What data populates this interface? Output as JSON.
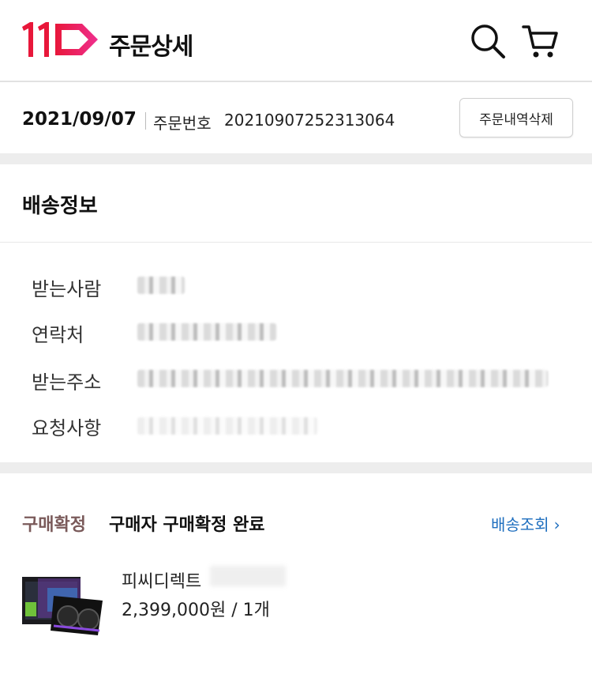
{
  "header": {
    "logo_text": "11",
    "title": "주문상세",
    "icons": [
      "search-icon",
      "cart-icon"
    ],
    "brand_color": "#e8173a",
    "brand_color_2": "#ef2f8e"
  },
  "order": {
    "date": "2021/09/07",
    "number_label": "주문번호",
    "number": "20210907252313064",
    "delete_label": "주문내역삭제"
  },
  "shipping": {
    "title": "배송정보",
    "labels": [
      "받는사람",
      "연락처",
      "받는주소",
      "요청사항"
    ]
  },
  "purchase": {
    "status_tag": "구매확정",
    "status_text": "구매자 구매확정 완료",
    "track_label": "배송조회",
    "seller": "피씨디렉트",
    "price": "2,399,000원",
    "qty": "1개",
    "status_color": "#7a5a5a",
    "link_color": "#1f6fbf"
  }
}
